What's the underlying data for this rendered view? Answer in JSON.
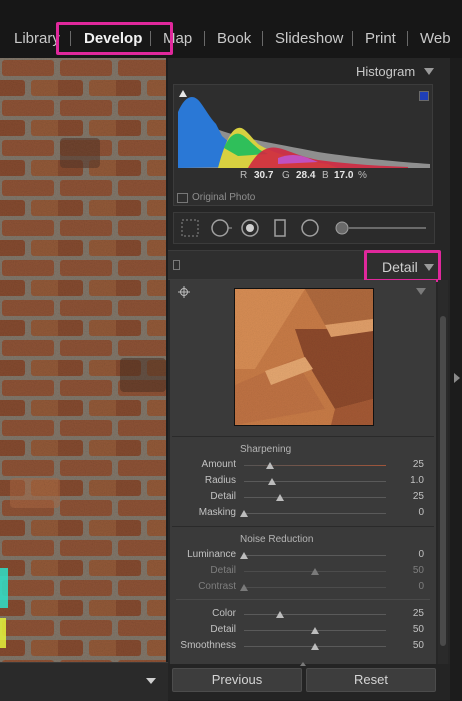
{
  "modules": [
    {
      "label": "Library"
    },
    {
      "label": "Develop"
    },
    {
      "label": "Map"
    },
    {
      "label": "Book"
    },
    {
      "label": "Slideshow"
    },
    {
      "label": "Print"
    },
    {
      "label": "Web"
    }
  ],
  "active_module": "Develop",
  "histogram": {
    "title": "Histogram",
    "r_label": "R",
    "r_value": "30.7",
    "g_label": "G",
    "g_value": "28.4",
    "b_label": "B",
    "b_value": "17.0",
    "unit": "%",
    "original_photo_label": "Original Photo"
  },
  "detail": {
    "title": "Detail",
    "sharpening": {
      "title": "Sharpening",
      "sliders": [
        {
          "label": "Amount",
          "value": "25",
          "fraction": 0.18
        },
        {
          "label": "Radius",
          "value": "1.0",
          "fraction": 0.2
        },
        {
          "label": "Detail",
          "value": "25",
          "fraction": 0.25
        },
        {
          "label": "Masking",
          "value": "0",
          "fraction": 0.0
        }
      ]
    },
    "noise_reduction": {
      "title": "Noise Reduction",
      "sliders": [
        {
          "label": "Luminance",
          "value": "0",
          "fraction": 0.0,
          "enabled": true
        },
        {
          "label": "Detail",
          "value": "50",
          "fraction": 0.5,
          "enabled": false
        },
        {
          "label": "Contrast",
          "value": "0",
          "fraction": 0.0,
          "enabled": false
        },
        {
          "label": "Color",
          "value": "25",
          "fraction": 0.25,
          "enabled": true
        },
        {
          "label": "Detail",
          "value": "50",
          "fraction": 0.5,
          "enabled": true
        },
        {
          "label": "Smoothness",
          "value": "50",
          "fraction": 0.5,
          "enabled": true
        }
      ]
    }
  },
  "buttons": {
    "previous": "Previous",
    "reset": "Reset"
  },
  "colors": {
    "highlight": "#e0289c",
    "panel": "#3a3a3a"
  },
  "icons": [
    "crop-overlay-icon",
    "spot-removal-icon",
    "red-eye-icon",
    "graduated-filter-icon",
    "radial-filter-icon",
    "adjustment-brush-icon",
    "target-adjust-icon",
    "clipping-indicator-icon"
  ]
}
